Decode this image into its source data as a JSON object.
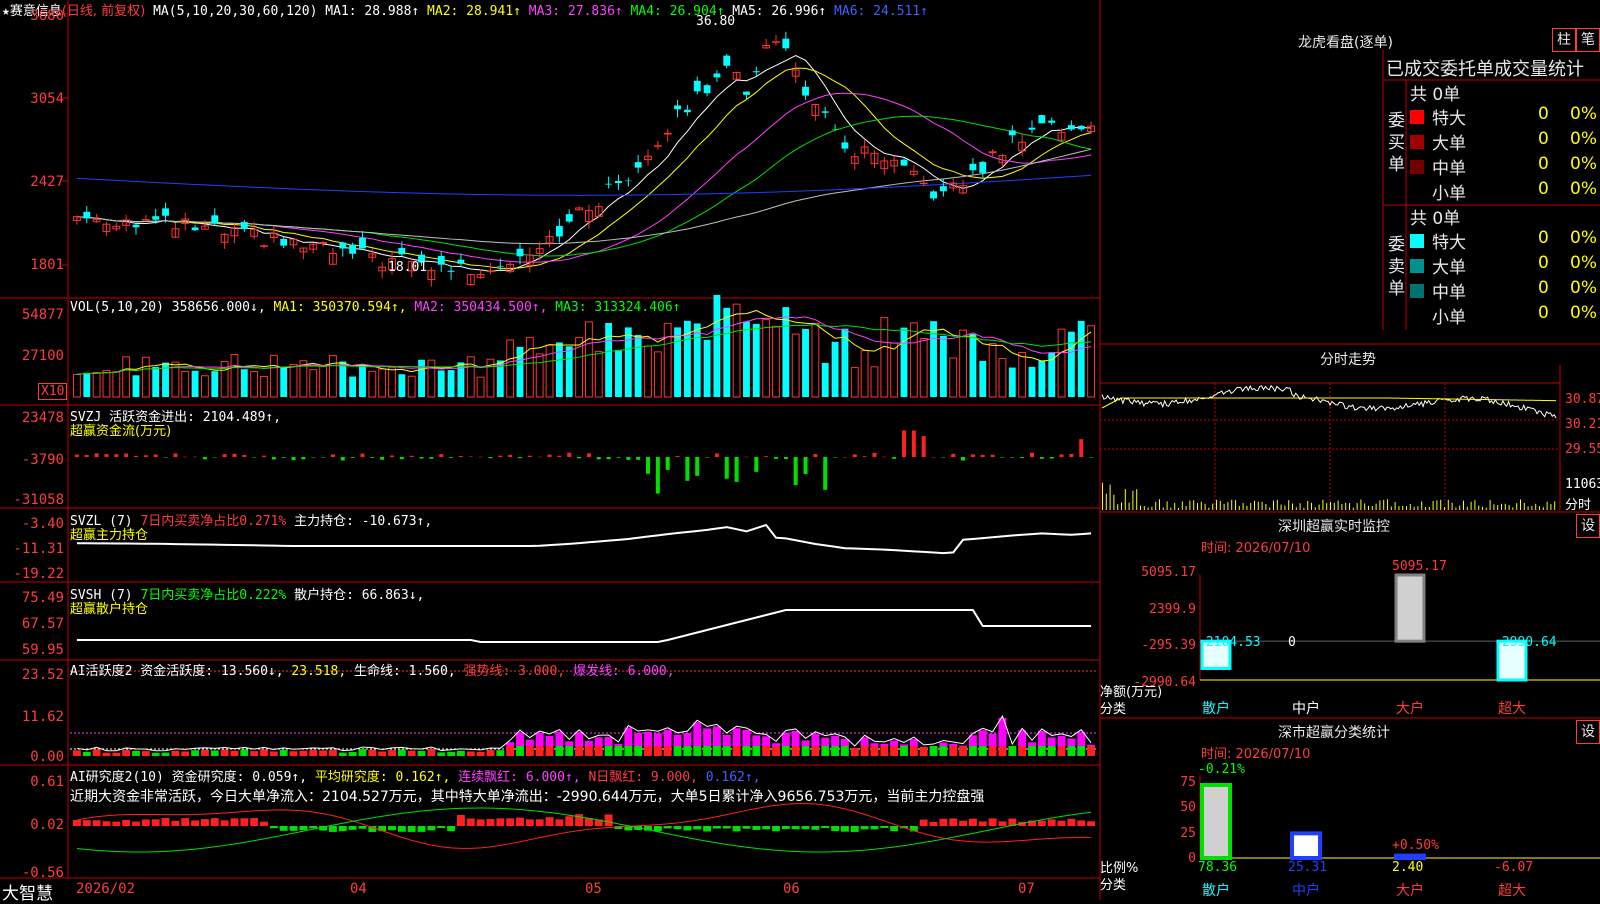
{
  "colors": {
    "up": "#ff3232",
    "down": "#00ffff",
    "bg": "#000000",
    "frame": "#c00000",
    "ma1": "#ffffff",
    "ma2": "#ffff00",
    "ma3": "#ff40ff",
    "ma4": "#00e000",
    "ma5": "#c0c0c0",
    "ma6": "#2040ff"
  },
  "header": {
    "star": "★",
    "stock": "赛意信息",
    "mode": "(日线, 前复权)",
    "ma_params": "MA(5,10,20,30,60,120)",
    "ma1": "MA1: 28.988↑",
    "ma2": "MA2: 28.941↑",
    "ma3": "MA3: 27.836↑",
    "ma4": "MA4: 26.904↑",
    "ma5": "MA5: 26.996↑",
    "ma6": "MA6: 24.511↑"
  },
  "price_axis": [
    "3680",
    "3054",
    "2427",
    "1801"
  ],
  "price_annotations": {
    "high": "36.80",
    "low": "18.01"
  },
  "vol": {
    "label": "VOL(5,10,20) 358656.000↓,",
    "ma1": "MA1: 350370.594↑,",
    "ma2": "MA2: 350434.500↑,",
    "ma3": "MA3: 313324.406↑",
    "axis": [
      "54877",
      "27100"
    ],
    "unit": "X10"
  },
  "svzj": {
    "label": "SVZJ  活跃资金进出: 2104.489↑,",
    "sub": "超赢资金流(万元)",
    "axis": [
      "23478",
      "-3790",
      "-31058"
    ]
  },
  "svzl": {
    "label": "SVZL (7)",
    "ratio": "7日内买卖净占比0.271%",
    "hold": "主力持仓: -10.673↑,",
    "sub": "超赢主力持仓",
    "axis": [
      "-3.40",
      "-11.31",
      "-19.22"
    ]
  },
  "svsh": {
    "label": "SVSH (7)",
    "ratio": "7日内买卖净占比0.222%",
    "hold": "散户持仓: 66.863↓,",
    "sub": "超赢散户持仓",
    "axis": [
      "75.49",
      "67.57",
      "59.95"
    ]
  },
  "ai1": {
    "label": "AI活跃度2 资金活跃度: 13.560↓,",
    "v2": "23.518,",
    "life": "生命线: 1.560,",
    "strong": "强势线: 3.000,",
    "burst": "爆发线: 6.000,",
    "axis": [
      "23.52",
      "11.62",
      "0.00"
    ]
  },
  "ai2": {
    "label": "AI研究度2(10) 资金研究度: 0.059↑,",
    "avg": "平均研究度: 0.162↑,",
    "cont": "连续飘红: 6.000↑,",
    "nday": "N日飘红: 9.000,",
    "tail": "0.162↑,",
    "note": "近期大资金非常活跃，今日大单净流入：2104.527万元，其中特大单净流出：-2990.644万元，大单5日累计净入9656.753万元，当前主力控盘强",
    "axis": [
      "0.61",
      "0.02",
      "-0.56"
    ]
  },
  "bottom": {
    "brand": "大智慧",
    "dates": [
      "2026/02",
      "04",
      "05",
      "06",
      "07"
    ]
  },
  "dragon": {
    "title": "龙虎看盘(逐单)",
    "btn_bar": "柱",
    "btn_pen": "笔",
    "heading": "已成交委托单成交量统计",
    "buy": {
      "label": "委买单",
      "total": "共 0单",
      "rows": [
        {
          "name": "特大",
          "v": "0",
          "p": "0%",
          "color": "#ff0000"
        },
        {
          "name": "大单",
          "v": "0",
          "p": "0%",
          "color": "#a00000"
        },
        {
          "name": "中单",
          "v": "0",
          "p": "0%",
          "color": "#700000"
        },
        {
          "name": "小单",
          "v": "0",
          "p": "0%",
          "color": "#000000"
        }
      ]
    },
    "sell": {
      "label": "委卖单",
      "total": "共 0单",
      "rows": [
        {
          "name": "特大",
          "v": "0",
          "p": "0%",
          "color": "#00ffff"
        },
        {
          "name": "大单",
          "v": "0",
          "p": "0%",
          "color": "#009090"
        },
        {
          "name": "中单",
          "v": "0",
          "p": "0%",
          "color": "#007070"
        },
        {
          "name": "小单",
          "v": "0",
          "p": "0%",
          "color": "#000000"
        }
      ]
    }
  },
  "intraday": {
    "title": "分时走势",
    "axis": [
      "30.87",
      "30.21",
      "29.55"
    ],
    "vol": "11063",
    "foot": "分时"
  },
  "szmon": {
    "title": "深圳超赢实时监控",
    "btn": "设",
    "time": "时间: 2026/07/10",
    "axis": [
      "5095.17",
      "2399.9",
      "-295.39",
      "-2990.64"
    ],
    "ylabel": "净额(万元)",
    "xlabel": "分类",
    "cats": [
      "散户",
      "中户",
      "大户",
      "超大"
    ],
    "values": [
      -2104.53,
      0,
      5095.17,
      -2990.64
    ],
    "labels": [
      "-2104.53",
      "0",
      "5095.17",
      "-2990.64"
    ]
  },
  "szcls": {
    "title": "深市超赢分类统计",
    "btn": "设",
    "time": "时间: 2026/07/10",
    "axis": [
      "75",
      "50",
      "25",
      "0"
    ],
    "ylabel": "比例%",
    "xlabel": "分类",
    "cats": [
      "散户",
      "中户",
      "大户",
      "超大"
    ],
    "values": [
      78.36,
      25.31,
      2.4,
      -6.07
    ],
    "labels": [
      "78.36",
      "25.31",
      "2.40",
      "-6.07"
    ],
    "changes": [
      "-0.21%",
      "",
      "+0.50%",
      ""
    ]
  }
}
